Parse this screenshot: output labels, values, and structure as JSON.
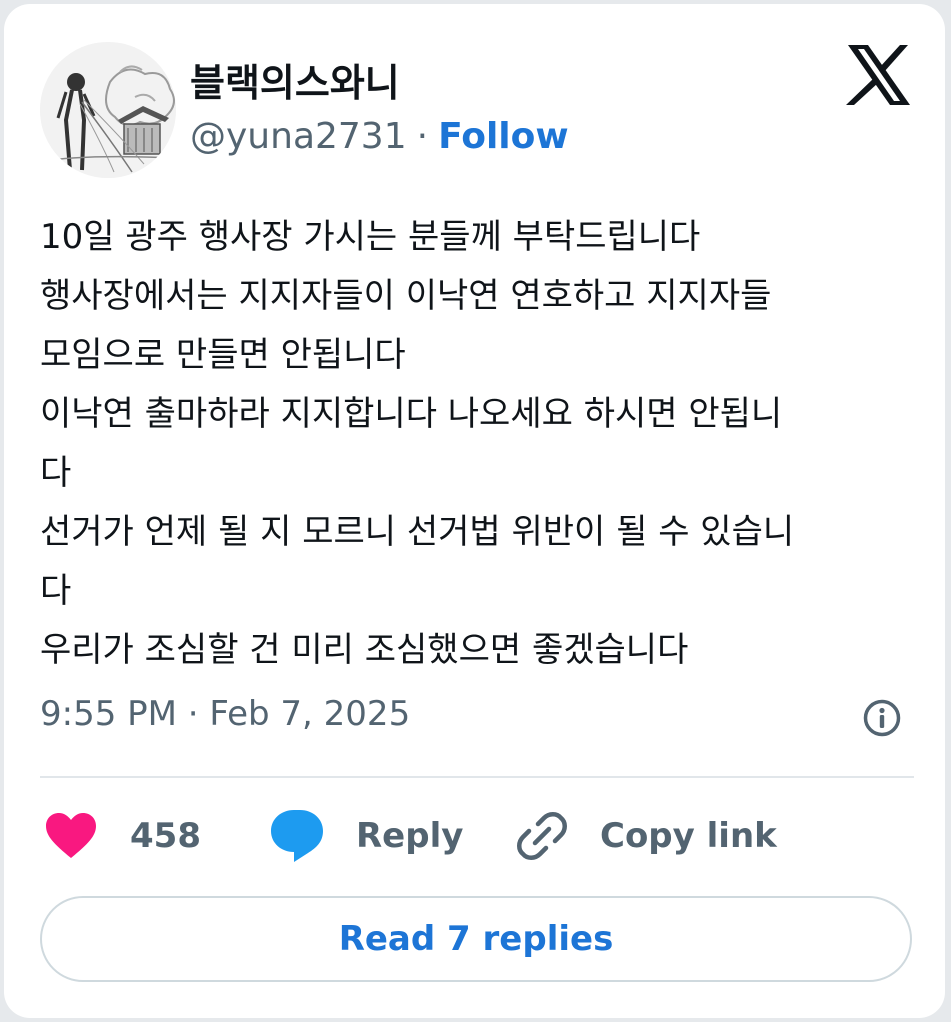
{
  "author": {
    "display_name": "블랙의스와니",
    "handle": "@yuna2731",
    "separator": "·",
    "follow_label": "Follow"
  },
  "tweet": {
    "lines": [
      "10일 광주 행사장 가시는 분들께 부탁드립니다",
      "행사장에서는 지지자들이 이낙연 연호하고 지지자들",
      "모임으로 만들면 안됩니다",
      "이낙연 출마하라 지지합니다 나오세요 하시면 안됩니",
      "다",
      "선거가 언제 될 지 모르니 선거법 위반이 될 수 있습니",
      "다",
      "우리가 조심할 건 미리 조심했으면 좋겠습니다"
    ],
    "timestamp": "9:55 PM · Feb 7, 2025"
  },
  "actions": {
    "like_count": "458",
    "reply_label": "Reply",
    "copy_link_label": "Copy link"
  },
  "read_replies_label": "Read 7 replies",
  "colors": {
    "like": "#f91880",
    "reply": "#1d9bf0",
    "link_blue": "#1d75d6",
    "muted": "#536471"
  }
}
